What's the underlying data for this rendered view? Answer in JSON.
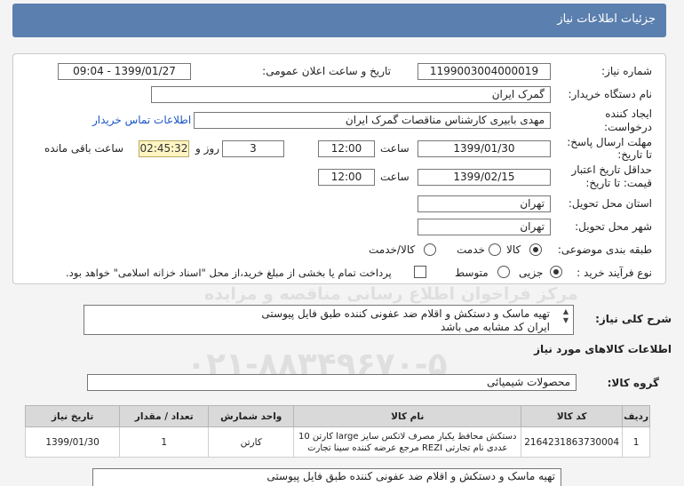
{
  "header": {
    "title": "جزئیات اطلاعات نیاز"
  },
  "fields": {
    "need_number_label": "شماره نیاز:",
    "need_number": "1199003004000019",
    "announce_label": "تاریخ و ساعت اعلان عمومی:",
    "announce_value": "1399/01/27 - 09:04",
    "buyer_label": "نام دستگاه خریدار:",
    "buyer_value": "گمرک ایران",
    "creator_label_1": "ایجاد کننده",
    "creator_label_2": "درخواست:",
    "creator_value": "مهدی بابیری کارشناس مناقصات گمرک ایران",
    "contact_link": "اطلاعات تماس خریدار",
    "deadline_label_1": "مهلت ارسال پاسخ:",
    "deadline_label_2": "تا تاریخ:",
    "deadline_date": "1399/01/30",
    "time_label": "ساعت",
    "deadline_time": "12:00",
    "days_value": "3",
    "days_label": "روز و",
    "remaining_time": "02:45:32",
    "remaining_label": "ساعت باقی مانده",
    "validity_label_1": "حداقل تاریخ اعتبار",
    "validity_label_2": "قیمت: تا تاریخ:",
    "validity_date": "1399/02/15",
    "validity_time": "12:00",
    "province_label": "استان محل تحویل:",
    "province_value": "تهران",
    "city_label": "شهر محل تحویل:",
    "city_value": "تهران",
    "category_label": "طبقه بندی موضوعی:",
    "category_options": [
      "کالا",
      "خدمت",
      "کالا/خدمت"
    ],
    "category_selected": "کالا",
    "process_label": "نوع فرآیند خرید :",
    "process_options": [
      "جزیی",
      "متوسط"
    ],
    "process_selected": "جزیی",
    "payment_note": "پرداخت تمام یا بخشی از مبلغ خرید،از محل \"اسناد خزانه اسلامی\" خواهد بود."
  },
  "description": {
    "label": "شرح کلی نیاز:",
    "line1": "تهیه ماسک و دستکش و اقلام ضد عفونی کننده طبق فایل پیوستی",
    "line2": "ایران کد مشابه می باشد"
  },
  "goods_info": {
    "title": "اطلاعات کالاهای مورد نیاز"
  },
  "goods_group": {
    "label": "گروه کالا:",
    "value": "محصولات شیمیائی"
  },
  "table": {
    "headers": [
      "ردیف",
      "کد کالا",
      "نام کالا",
      "واحد شمارش",
      "تعداد / مقدار",
      "تاریخ نیاز"
    ],
    "rows": [
      {
        "row": "1",
        "code": "2164231863730004",
        "name": "دستکش محافظ یکبار مصرف لاتکس سایز large کارتن 10 عددی نام تجارتی REZI مرجع عرضه کننده سینا تجارت",
        "unit": "کارتن",
        "qty": "1",
        "date": "1399/01/30"
      }
    ]
  },
  "bottom_text": "تهیه ماسک و دستکش و اقلام ضد عفونی کننده طبق فایل پیوستی",
  "watermark": {
    "line1": "مرکز فراخوان اطلاع رسانی مناقصه و مزایده",
    "line2": "۰۲۱-۸۸۳۴۹۶۷۰-۵"
  }
}
